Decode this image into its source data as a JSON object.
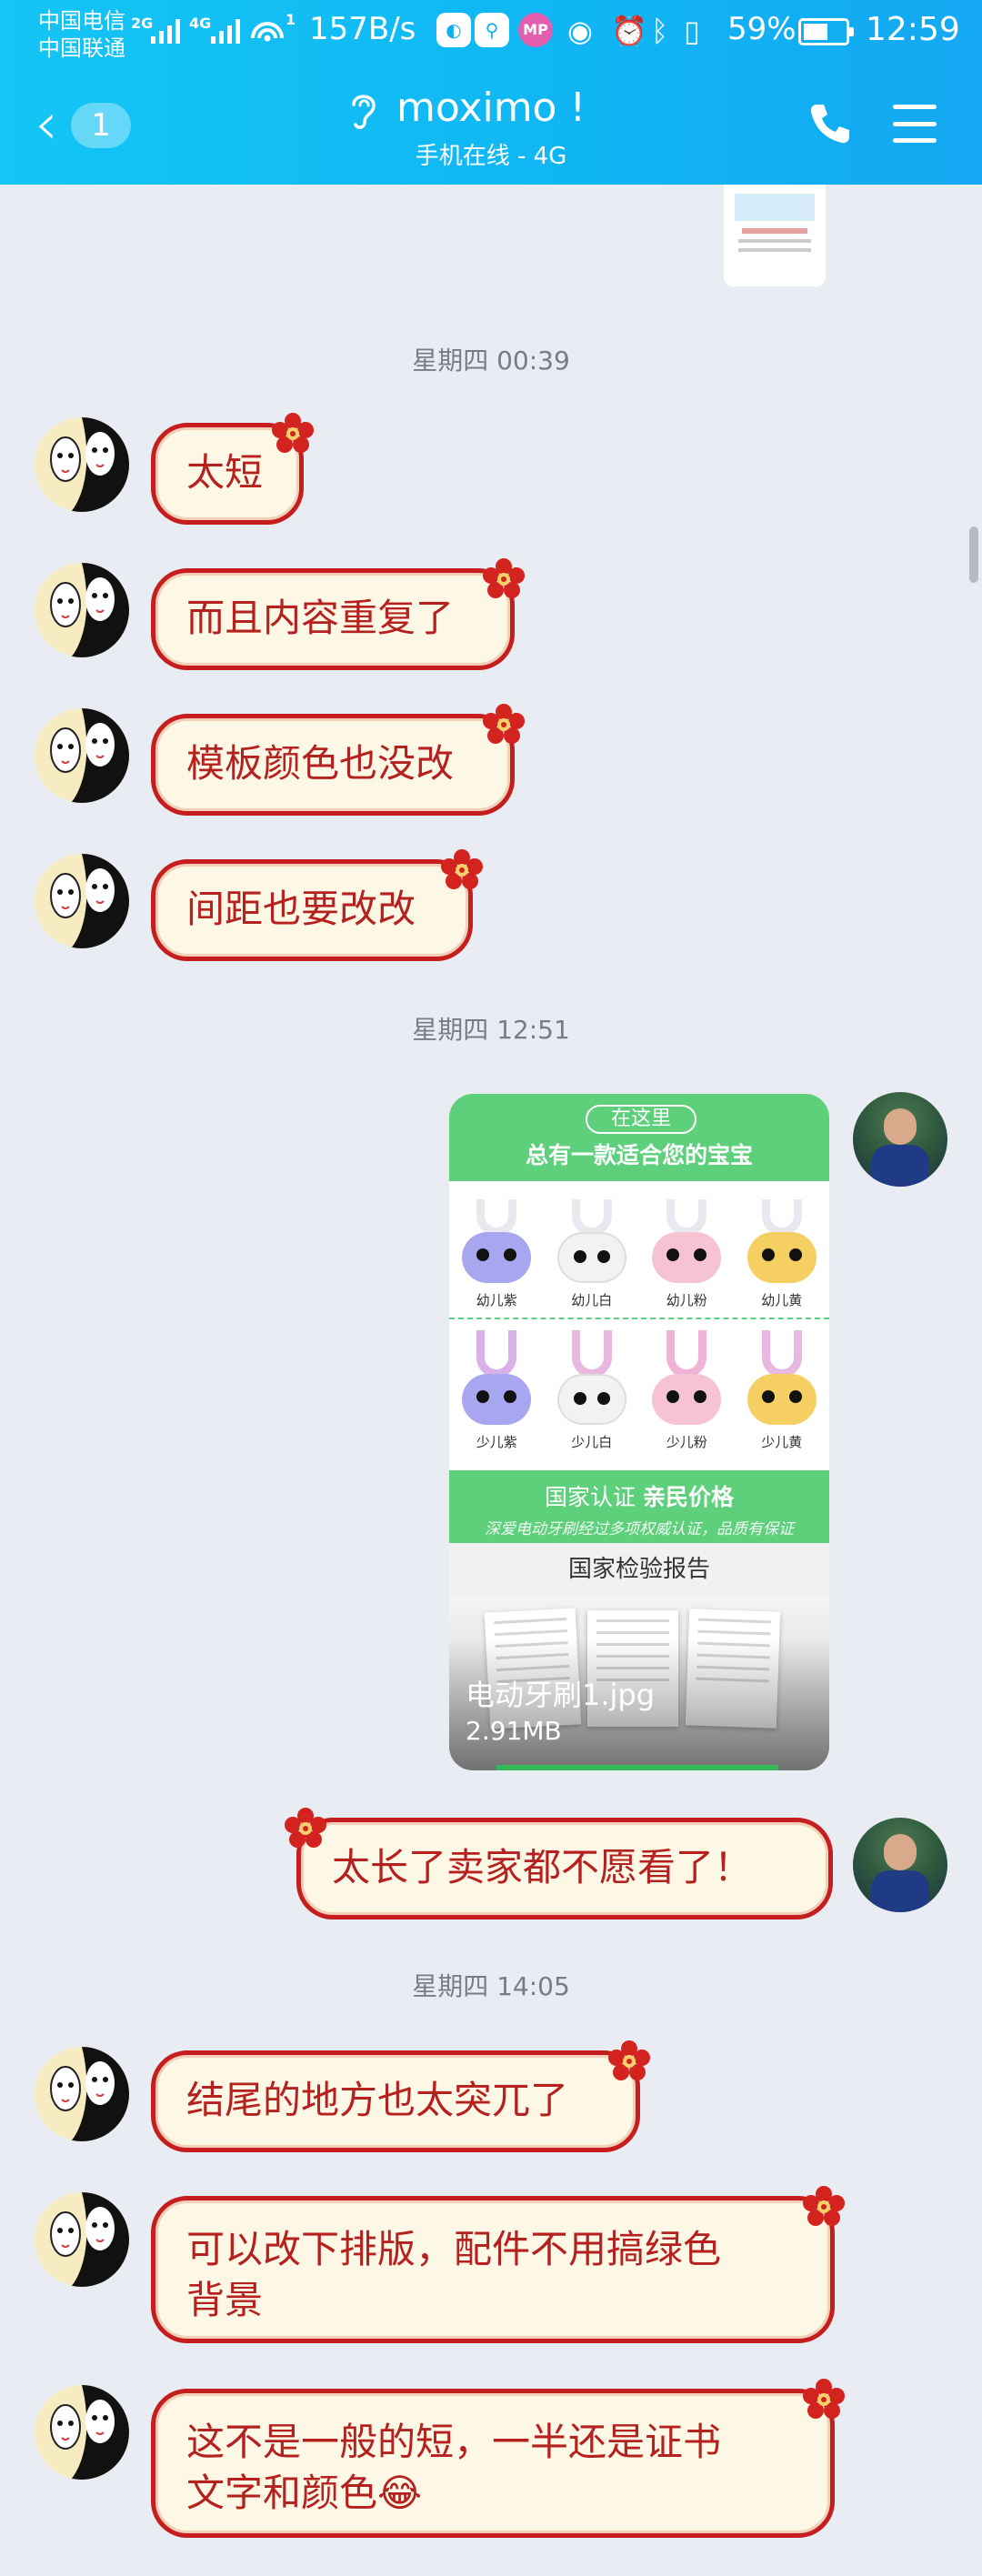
{
  "status_bar": {
    "carrier_1": "中国电信",
    "carrier_2": "中国联通",
    "net_type_1": "2G",
    "net_type_2": "4G",
    "hotspot_badge": "1",
    "net_speed": "157B/s",
    "app_icons": [
      "file-transfer-icon",
      "maps-icon",
      "mp-app-icon"
    ],
    "app_icon_mp_label": "MP",
    "system_icons": [
      "eye-icon",
      "alarm-icon",
      "bluetooth-icon",
      "vibrate-icon"
    ],
    "battery_pct_text": "59%",
    "battery_level": 0.59,
    "time": "12:59"
  },
  "header": {
    "unread_count": "1",
    "contact_name": "moximo !",
    "contact_status": "手机在线 - 4G",
    "icons": [
      "back-arrow-icon",
      "ear-mode-icon",
      "phone-call-icon",
      "menu-icon"
    ]
  },
  "messages": {
    "ts1": "星期四 00:39",
    "m1": "太短",
    "m2": "而且内容重复了",
    "m3": "模板颜色也没改",
    "m4": "间距也要改改",
    "ts2": "星期四 12:51",
    "image_card": {
      "pill": "在这里",
      "headline": "总有一款适合您的宝宝",
      "row1": [
        "幼儿紫",
        "幼儿白",
        "幼儿粉",
        "幼儿黄"
      ],
      "row2": [
        "少儿紫",
        "少儿白",
        "少儿粉",
        "少儿黄"
      ],
      "cert_line_a": "国家认证",
      "cert_line_b": "亲民价格",
      "cert_sub": "深爱电动牙刷经过多项权威认证，品质有保证",
      "report_title": "国家检验报告",
      "file_name": "电动牙刷1.jpg",
      "file_size": "2.91MB"
    },
    "m5_self": "太长了卖家都不愿看了！",
    "ts3": "星期四 14:05",
    "m6": "结尾的地方也太突兀了",
    "m7_line1": "可以改下排版，配件不用搞绿色",
    "m7_line2": "背景",
    "m8_line1": "这不是一般的短，一半还是证书",
    "m8_line2": "文字和颜色😂"
  },
  "colors": {
    "header_blue": "#10b7f4",
    "chat_bg": "#e9ecf2",
    "bubble_border": "#c51e1e",
    "bubble_fill": "#fdf7e6",
    "bubble_text": "#b5211f",
    "card_green": "#5ed07b"
  }
}
